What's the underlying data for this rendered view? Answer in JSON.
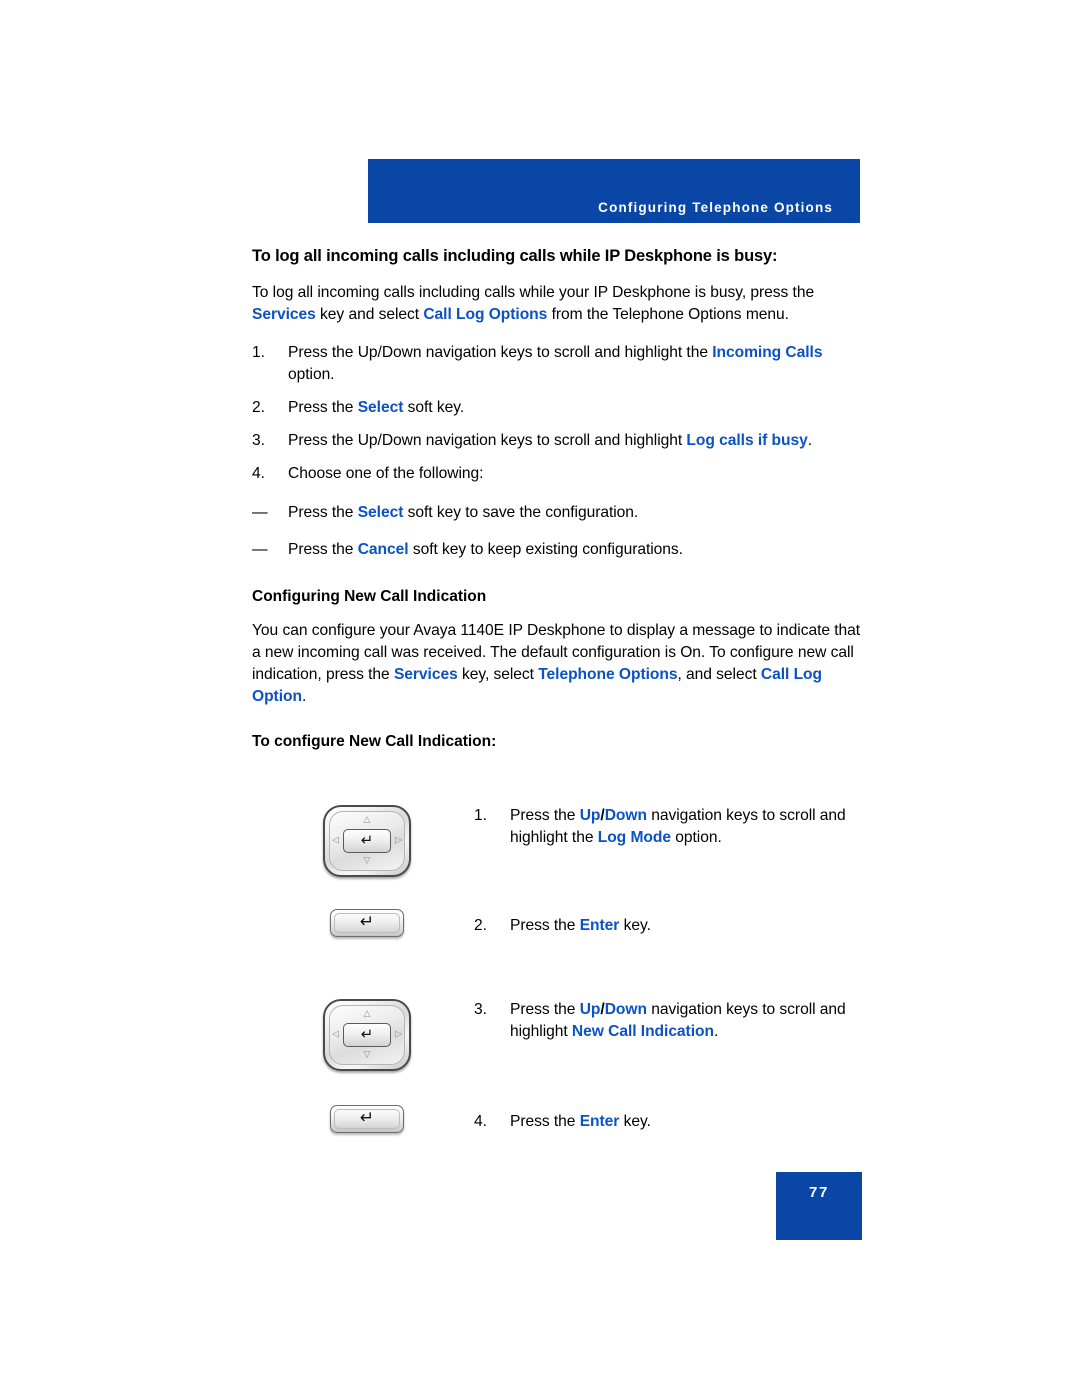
{
  "header": {
    "banner_title": "Configuring Telephone Options",
    "banner_color": "#0a46a5"
  },
  "accent": {
    "link_blue": "#0b52c4",
    "banner_blue": "#0a46a5"
  },
  "section1": {
    "heading": "To log all incoming calls including calls while IP Deskphone is busy:",
    "intro": {
      "part1": "To log all incoming calls including calls while your IP Deskphone is busy, press the ",
      "term1": "Services",
      "part2": " key and select ",
      "term2": "Call Log Options",
      "part3": " from the Telephone Options menu."
    },
    "steps": [
      {
        "num": "1.",
        "part1": "Press the Up/Down navigation keys to scroll and highlight the ",
        "term1": "Incoming Calls",
        "part2": " option."
      },
      {
        "num": "2.",
        "part1": "Press the ",
        "term1": "Select",
        "part2": " soft key."
      },
      {
        "num": "3.",
        "part1": "Press the Up/Down navigation keys to scroll and highlight ",
        "term1": "Log calls if busy",
        "part2": "."
      },
      {
        "num": "4.",
        "part1": "Choose one of the following:",
        "term1": "",
        "part2": ""
      }
    ],
    "dash_items": [
      {
        "dash": "—",
        "part1": "Press the ",
        "term1": "Select",
        "part2": " soft key to save the configuration."
      },
      {
        "dash": "—",
        "part1": "Press the ",
        "term1": "Cancel",
        "part2": " soft key to keep existing configurations."
      }
    ]
  },
  "section2": {
    "heading": "Configuring New Call Indication",
    "body": {
      "part1": "You can configure your Avaya 1140E IP Deskphone to display a message to indicate that a new incoming call was received. The default configuration is On. To configure new call indication, press the ",
      "term1": "Services",
      "part2": " key, select ",
      "term2": "Telephone Options",
      "part3": ", and select ",
      "term3": "Call Log Option",
      "part4": "."
    },
    "subheading": "To configure New Call Indication:",
    "key_steps": [
      {
        "icon": "navigation-cluster-key-icon",
        "num": "1.",
        "part1": "Press the ",
        "term1": "Up",
        "slash": "/",
        "term2": "Down",
        "part2": " navigation keys to scroll and highlight the ",
        "term3": "Log Mode",
        "part3": " option."
      },
      {
        "icon": "enter-key-icon",
        "num": "2.",
        "part1": "Press the ",
        "term1": "Enter",
        "slash": "",
        "term2": "",
        "part2": "",
        "term3": "",
        "part3": " key."
      },
      {
        "icon": "navigation-cluster-key-icon",
        "num": "3.",
        "part1": "Press the ",
        "term1": "Up",
        "slash": "/",
        "term2": "Down",
        "part2": " navigation keys to scroll and highlight ",
        "term3": "New Call Indication",
        "part3": "."
      },
      {
        "icon": "enter-key-icon",
        "num": "4.",
        "part1": "Press the ",
        "term1": "Enter",
        "slash": "",
        "term2": "",
        "part2": "",
        "term3": "",
        "part3": " key."
      }
    ]
  },
  "footer": {
    "page_number": "77"
  },
  "icons": {
    "enter_glyph": "↵",
    "arrow_up": "△",
    "arrow_down": "▽",
    "arrow_left": "◁",
    "arrow_right": "▷"
  }
}
